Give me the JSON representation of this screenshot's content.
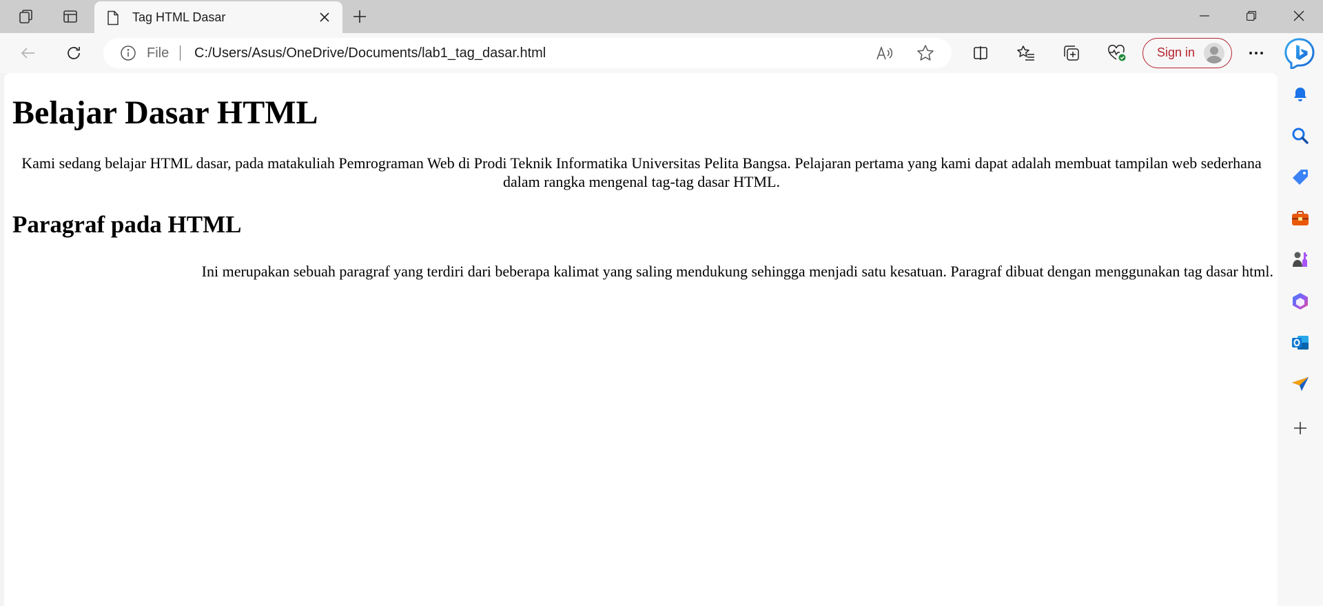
{
  "tab": {
    "title": "Tag HTML Dasar",
    "favicon": "page-icon"
  },
  "address_bar": {
    "scheme_label": "File",
    "url": "C:/Users/Asus/OneDrive/Documents/lab1_tag_dasar.html"
  },
  "profile": {
    "sign_in_label": "Sign in"
  },
  "page": {
    "heading1": "Belajar Dasar HTML",
    "paragraph1": "Kami sedang belajar HTML dasar, pada matakuliah Pemrograman Web di Prodi Teknik Informatika Universitas Pelita Bangsa. Pelajaran pertama yang kami dapat adalah membuat tampilan web sederhana dalam rangka mengenal tag-tag dasar HTML.",
    "heading2": "Paragraf pada HTML",
    "paragraph2": "Ini merupakan sebuah paragraf yang terdiri dari beberapa kalimat yang saling mendukung sehingga menjadi satu kesatuan. Paragraf dibuat dengan menggunakan tag dasar html."
  },
  "sidebar": {
    "items": [
      "bell-icon",
      "search-icon",
      "shopping-tag-icon",
      "tools-briefcase-icon",
      "games-icon",
      "office-icon",
      "outlook-icon",
      "send-icon",
      "add-icon"
    ]
  },
  "colors": {
    "tabstrip": "#cdcdcd",
    "toolbar": "#f7f7f7",
    "sign_in_accent": "#b7212d",
    "page_background": "#ffffff"
  }
}
